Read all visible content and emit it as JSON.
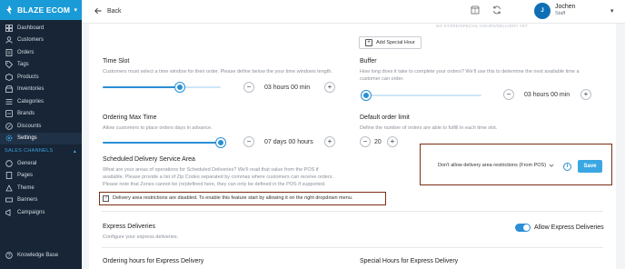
{
  "brand": {
    "name": "BLAZE ECOM"
  },
  "sidebar": {
    "items": [
      {
        "label": "Dashboard",
        "icon": "dashboard-icon"
      },
      {
        "label": "Customers",
        "icon": "customers-icon"
      },
      {
        "label": "Orders",
        "icon": "orders-icon"
      },
      {
        "label": "Tags",
        "icon": "tag-icon"
      },
      {
        "label": "Products",
        "icon": "products-icon"
      },
      {
        "label": "Inventories",
        "icon": "inventories-icon"
      },
      {
        "label": "Categories",
        "icon": "categories-icon"
      },
      {
        "label": "Brands",
        "icon": "brands-icon"
      },
      {
        "label": "Discounts",
        "icon": "discounts-icon"
      },
      {
        "label": "Settings",
        "icon": "gear-icon",
        "active": true
      }
    ],
    "section": "SALES CHANNELS",
    "channels": [
      {
        "label": "General",
        "icon": "general-icon"
      },
      {
        "label": "Pages",
        "icon": "pages-icon"
      },
      {
        "label": "Theme",
        "icon": "theme-icon"
      },
      {
        "label": "Banners",
        "icon": "banners-icon"
      },
      {
        "label": "Campaigns",
        "icon": "campaigns-icon"
      }
    ],
    "bottom": {
      "label": "Knowledge Base",
      "icon": "knowledge-base-icon"
    }
  },
  "topbar": {
    "back_label": "Back",
    "user": {
      "name": "Jochen",
      "role": "Staff",
      "initials": "J"
    }
  },
  "main": {
    "faded_note": "NO STORE/SPECIAL HOURS/DELIVERY YET",
    "add_special_hour": "Add Special Hour",
    "time_slot": {
      "title": "Time Slot",
      "desc": "Customers must select a time window for their order. Please define below the your time windows length.",
      "value": "03 hours 00 min",
      "fill": 0.65
    },
    "buffer": {
      "title": "Buffer",
      "desc_line1": "How long does it take to complete your orders? We'll use this to determine the next available time a",
      "desc_line2": "customer can order.",
      "value": "03 hours 00 min",
      "fill": 0.02
    },
    "ordering_max_time": {
      "title": "Ordering Max Time",
      "desc": "Allow customers to place orders days in advance.",
      "value": "07 days 00 hours",
      "fill": 1.0
    },
    "default_order_limit": {
      "title": "Default order limit",
      "desc": "Define the number of orders are able to fulfill in each time slot.",
      "value": "20"
    },
    "scheduled_delivery": {
      "title": "Scheduled Delivery Service Area",
      "desc_line1": "What are your areas of operations for Scheduled Deliveries? We'll read that value from the POS if",
      "desc_line2": "available. Please provide a list of Zip Codes separated by commas where customers can receive orders.",
      "desc_line3": "Please note that Zones cannot be (re)defined here, they can only be defined in the POS if supported.",
      "notice": "Delivery area restrictions are disabled. To enable this feature start by allowing it on the right dropdown menu."
    },
    "restriction_select": {
      "value": "Don't allow delivery area restrictions  (From POS)",
      "save_label": "Save"
    },
    "express": {
      "title": "Express Deliveries",
      "desc": "Configure your express deliveries.",
      "toggle_label": "Allow Express Deliveries",
      "toggle_on": true
    },
    "ordering_hours_express": {
      "title": "Ordering hours for Express Delivery"
    },
    "special_hours_express": {
      "title": "Special Hours for Express Delivery"
    }
  },
  "colors": {
    "accent": "#2a8fd6",
    "sidebar": "#172536",
    "brand_bar": "#1a9bd7",
    "highlight": "#7b2d12"
  }
}
